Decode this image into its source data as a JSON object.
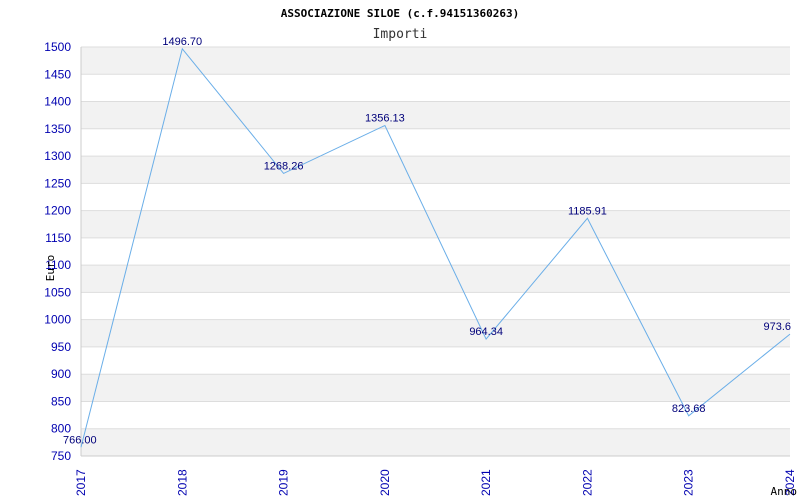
{
  "chart_data": {
    "type": "line",
    "title": "ASSOCIAZIONE SILOE (c.f.94151360263)",
    "subtitle": "Importi",
    "xlabel": "Anno",
    "ylabel": "Euro",
    "x": [
      "2017",
      "2018",
      "2019",
      "2020",
      "2021",
      "2022",
      "2023",
      "2024"
    ],
    "values": [
      766.0,
      1496.7,
      1268.26,
      1356.13,
      964.34,
      1185.91,
      823.68,
      973.6
    ],
    "value_labels": [
      "766.00",
      "1496.70",
      "1268.26",
      "1356.13",
      "964.34",
      "1185.91",
      "823.68",
      "973.6"
    ],
    "ylim": [
      750,
      1500
    ],
    "yticks": [
      "750",
      "800",
      "850",
      "900",
      "950",
      "1000",
      "1050",
      "1100",
      "1150",
      "1200",
      "1250",
      "1300",
      "1350",
      "1400",
      "1450",
      "1500"
    ],
    "grid": true,
    "colors": {
      "line": "#6aaee8",
      "band": "#f2f2f2",
      "grid": "#dddddd",
      "tick": "#0000b0",
      "label": "#00007a"
    }
  }
}
